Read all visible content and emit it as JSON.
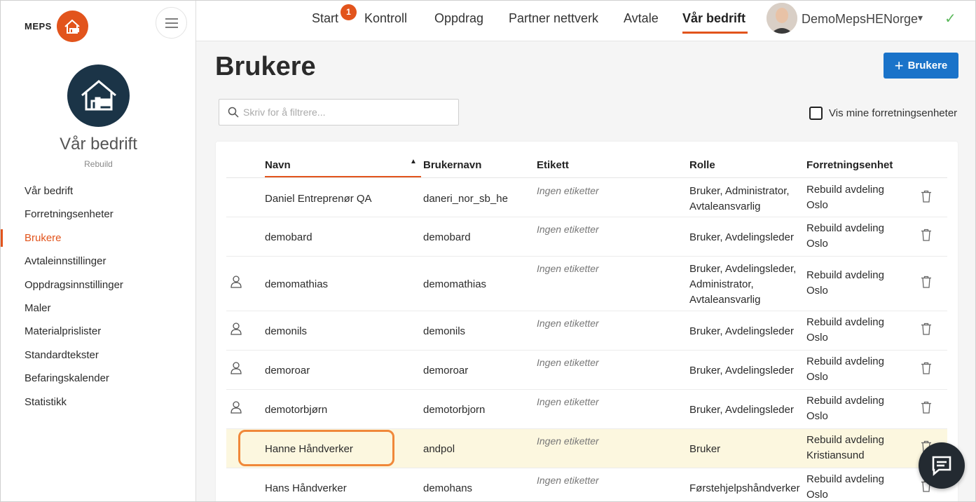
{
  "brand": {
    "text": "MEPS",
    "color": "#e2541c"
  },
  "sidebar": {
    "company_name": "Vår bedrift",
    "company_sub": "Rebuild",
    "items": [
      {
        "label": "Vår bedrift",
        "active": false
      },
      {
        "label": "Forretningsenheter",
        "active": false
      },
      {
        "label": "Brukere",
        "active": true
      },
      {
        "label": "Avtaleinnstillinger",
        "active": false
      },
      {
        "label": "Oppdragsinnstillinger",
        "active": false
      },
      {
        "label": "Maler",
        "active": false
      },
      {
        "label": "Materialprislister",
        "active": false
      },
      {
        "label": "Standardtekster",
        "active": false
      },
      {
        "label": "Befaringskalender",
        "active": false
      },
      {
        "label": "Statistikk",
        "active": false
      }
    ]
  },
  "topnav": {
    "items": [
      "Start",
      "Kontroll",
      "Oppdrag",
      "Partner nettverk",
      "Avtale",
      "Vår bedrift"
    ],
    "active": "Vår bedrift",
    "badge": "1",
    "user_name": "DemoMepsHENorge"
  },
  "page": {
    "title": "Brukere",
    "add_button": "Brukere",
    "search_placeholder": "Skriv for å filtrere...",
    "checkbox_label": "Vis mine forretningsenheter"
  },
  "table": {
    "headers": [
      "Navn",
      "Brukernavn",
      "Etikett",
      "Rolle",
      "Forretningsenhet"
    ],
    "rows": [
      {
        "name": "Daniel Entreprenør QA",
        "username": "daneri_nor_sb_he",
        "tag": "Ingen etiketter",
        "role": [
          "Bruker, Administrator,",
          "Avtaleansvarlig"
        ],
        "unit": [
          "Rebuild avdeling",
          "Oslo"
        ],
        "icon": false,
        "highlight": false
      },
      {
        "name": "demobard",
        "username": "demobard",
        "tag": "Ingen etiketter",
        "role": [
          "Bruker, Avdelingsleder"
        ],
        "unit": [
          "Rebuild avdeling",
          "Oslo"
        ],
        "icon": false,
        "highlight": false
      },
      {
        "name": "demomathias",
        "username": "demomathias",
        "tag": "Ingen etiketter",
        "role": [
          "Bruker, Avdelingsleder,",
          "Administrator,",
          "Avtaleansvarlig"
        ],
        "unit": [
          "Rebuild avdeling",
          "Oslo"
        ],
        "icon": true,
        "highlight": false
      },
      {
        "name": "demonils",
        "username": "demonils",
        "tag": "Ingen etiketter",
        "role": [
          "Bruker, Avdelingsleder"
        ],
        "unit": [
          "Rebuild avdeling",
          "Oslo"
        ],
        "icon": true,
        "highlight": false
      },
      {
        "name": "demoroar",
        "username": "demoroar",
        "tag": "Ingen etiketter",
        "role": [
          "Bruker, Avdelingsleder"
        ],
        "unit": [
          "Rebuild avdeling",
          "Oslo"
        ],
        "icon": true,
        "highlight": false
      },
      {
        "name": "demotorbjørn",
        "username": "demotorbjorn",
        "tag": "Ingen etiketter",
        "role": [
          "Bruker, Avdelingsleder"
        ],
        "unit": [
          "Rebuild avdeling",
          "Oslo"
        ],
        "icon": true,
        "highlight": false
      },
      {
        "name": "Hanne Håndverker",
        "username": "andpol",
        "tag": "Ingen etiketter",
        "role": [
          "Bruker"
        ],
        "unit": [
          "Rebuild avdeling",
          "Kristiansund"
        ],
        "icon": false,
        "highlight": true
      },
      {
        "name": "Hans Håndverker",
        "username": "demohans",
        "tag": "Ingen etiketter",
        "role": [
          "Førstehjelpshåndverker"
        ],
        "unit": [
          "Rebuild avdeling",
          "Oslo"
        ],
        "icon": false,
        "highlight": false
      }
    ]
  }
}
